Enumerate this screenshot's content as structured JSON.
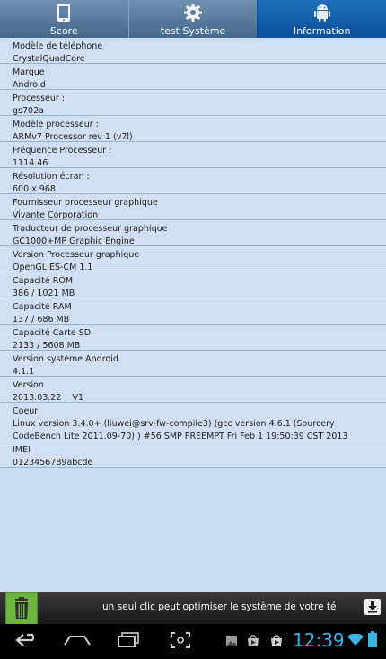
{
  "tabs": [
    {
      "label": "Score",
      "icon": "phone-icon"
    },
    {
      "label": "test Système",
      "icon": "gear-icon"
    },
    {
      "label": "Information",
      "icon": "android-icon",
      "active": true
    }
  ],
  "info": [
    {
      "label": "Modèle de téléphone",
      "value": "CrystalQuadCore"
    },
    {
      "label": "Marque",
      "value": "Android"
    },
    {
      "label": "Processeur :",
      "value": "gs702a"
    },
    {
      "label": "Modèle processeur :",
      "value": "ARMv7 Processor rev 1 (v7l)"
    },
    {
      "label": "Fréquence Processeur :",
      "value": "1114.46"
    },
    {
      "label": "Résolution écran :",
      "value": "600 x 968"
    },
    {
      "label": "Fournisseur processeur graphique",
      "value": "Vivante Corporation"
    },
    {
      "label": "Traducteur de processeur graphique",
      "value": "GC1000+MP Graphic Engine"
    },
    {
      "label": "Version Processeur graphique",
      "value": "OpenGL ES-CM 1.1"
    },
    {
      "label": "Capacité ROM",
      "value": "386 / 1021 MB"
    },
    {
      "label": "Capacité RAM",
      "value": "137 / 686 MB"
    },
    {
      "label": "Capacité Carte SD",
      "value": "2133 / 5608 MB"
    },
    {
      "label": "Version système Android",
      "value": "4.1.1"
    },
    {
      "label": "Version",
      "value": "2013.03.22    V1"
    },
    {
      "label": "Coeur",
      "value": "Linux version 3.4.0+ (liuwei@srv-fw-compile3) (gcc version 4.6.1 (Sourcery CodeBench Lite 2011.09-70) ) #56 SMP PREEMPT Fri Feb 1 19:50:39 CST 2013"
    },
    {
      "label": "IMEI",
      "value": "0123456789abcde"
    }
  ],
  "ad": {
    "text": "un seul clic peut optimiser le système de votre té",
    "icon": "trash-icon",
    "download_icon": "download-icon"
  },
  "statusbar": {
    "time": "12:39"
  },
  "colors": {
    "active_tab": "#0a4f99",
    "list_bg": "#cfe0f4",
    "clock": "#38b4e6"
  }
}
